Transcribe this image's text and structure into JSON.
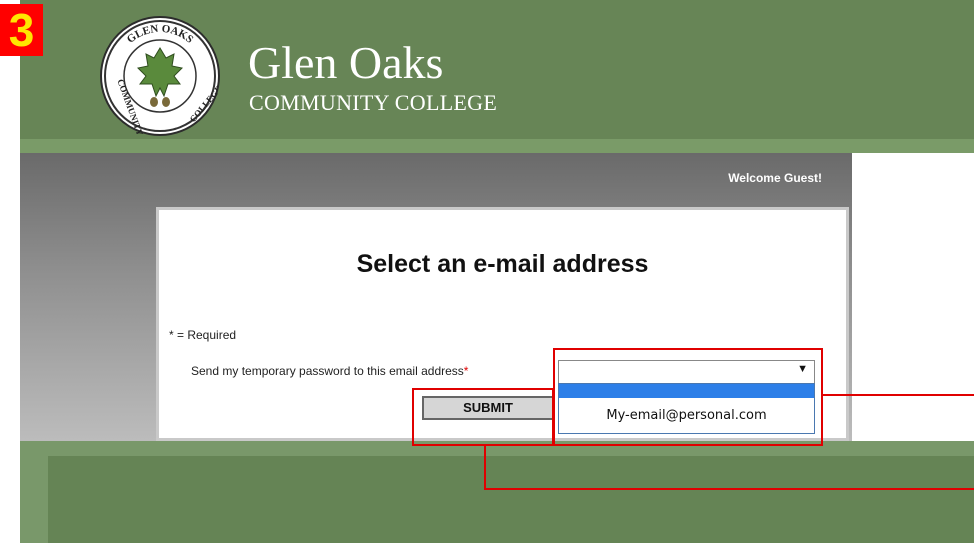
{
  "badge": {
    "label": "3"
  },
  "brand": {
    "name": "Glen Oaks",
    "subtitle": "COMMUNITY COLLEGE",
    "seal_text_top": "GLEN OAKS",
    "seal_text_left": "COMMUNITY",
    "seal_text_right": "COLLEGE"
  },
  "header": {
    "welcome": "Welcome Guest!"
  },
  "form": {
    "title": "Select an e-mail address",
    "required_note": "* = Required",
    "field_label": "Send my temporary password to this email address",
    "required_star": "*",
    "select_value": "",
    "select_arrow": "▼",
    "dropdown_options": [
      "My-email@personal.com"
    ],
    "submit_label": "SUBMIT"
  },
  "colors": {
    "header_green": "#678556",
    "footer_green": "#79986a",
    "annotation_red": "#e00000",
    "badge_red": "#ff0000",
    "badge_text": "#ffe600",
    "dropdown_highlight": "#2d7fe8"
  }
}
